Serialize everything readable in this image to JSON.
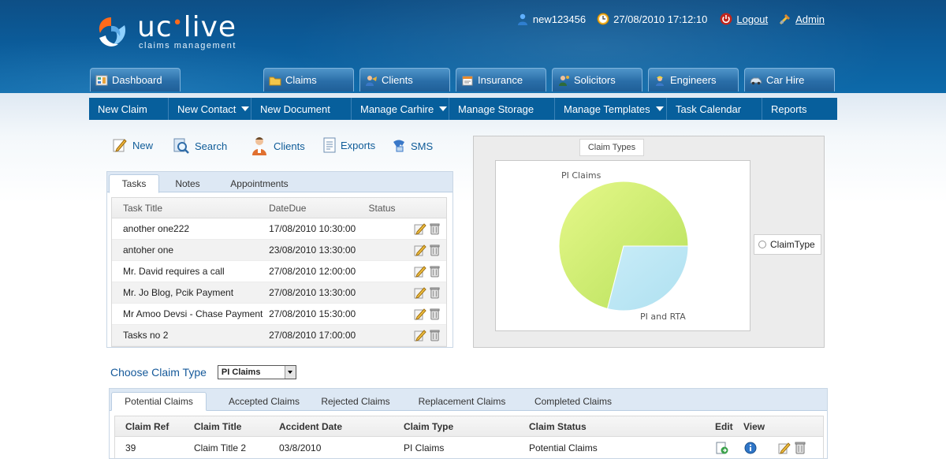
{
  "header": {
    "logo_main": "uc",
    "logo_dot": "•",
    "logo_tail": "live",
    "logo_sub": "claims management",
    "user": "new123456",
    "datetime": "27/08/2010 17:12:10",
    "logout_label": "Logout",
    "admin_label": "Admin"
  },
  "main_tabs": [
    {
      "label": "Dashboard",
      "icon": "dashboard-icon"
    },
    {
      "label": "Claims",
      "icon": "folder-icon"
    },
    {
      "label": "Clients",
      "icon": "clients-icon"
    },
    {
      "label": "Insurance",
      "icon": "insurance-icon"
    },
    {
      "label": "Solicitors",
      "icon": "solicitors-icon"
    },
    {
      "label": "Engineers",
      "icon": "engineers-icon"
    },
    {
      "label": "Car Hire",
      "icon": "car-icon"
    }
  ],
  "subnav": [
    {
      "label": "New Claim",
      "dropdown": false
    },
    {
      "label": "New Contact",
      "dropdown": true
    },
    {
      "label": "New Document",
      "dropdown": false
    },
    {
      "label": "Manage Carhire",
      "dropdown": true
    },
    {
      "label": "Manage Storage",
      "dropdown": false
    },
    {
      "label": "Manage Templates",
      "dropdown": true
    },
    {
      "label": "Task Calendar",
      "dropdown": false
    },
    {
      "label": "Reports",
      "dropdown": false
    }
  ],
  "quick": {
    "new": "New",
    "search": "Search",
    "clients": "Clients",
    "exports": "Exports",
    "sms": "SMS"
  },
  "tasks_panel": {
    "tabs": [
      "Tasks",
      "Notes",
      "Appointments"
    ],
    "columns": [
      "Task Title",
      "DateDue",
      "Status"
    ],
    "rows": [
      {
        "title": "another one222",
        "due": "17/08/2010 10:30:00"
      },
      {
        "title": "antoher one",
        "due": "23/08/2010 13:30:00"
      },
      {
        "title": "Mr. David requires a call",
        "due": "27/08/2010 12:00:00"
      },
      {
        "title": "Mr. Jo Blog, Pcik Payment",
        "due": "27/08/2010 13:30:00"
      },
      {
        "title": "Mr Amoo Devsi - Chase Payment",
        "due": "27/08/2010 15:30:00"
      },
      {
        "title": "Tasks no 2",
        "due": "27/08/2010 17:00:00"
      }
    ]
  },
  "chart_data": {
    "type": "pie",
    "title": "Claim Types",
    "legend": [
      "ClaimType"
    ],
    "legend_position": "right",
    "categories": [
      "PI Claims",
      "PI and RTA"
    ],
    "values": [
      71,
      29
    ],
    "colors": [
      "#b6e05a",
      "#aee0f0"
    ]
  },
  "choose": {
    "label": "Choose Claim Type",
    "selected": "PI Claims"
  },
  "claims_panel": {
    "tabs": [
      "Potential Claims",
      "Accepted Claims",
      "Rejected Claims",
      "Replacement Claims",
      "Completed Claims"
    ],
    "columns": [
      "Claim Ref",
      "Claim Title",
      "Accident Date",
      "Claim Type",
      "Claim Status",
      "Edit",
      "View"
    ],
    "rows": [
      {
        "ref": "39",
        "title": "Claim Title 2",
        "date": "03/8/2010",
        "type": "PI Claims",
        "status": "Potential Claims"
      }
    ]
  }
}
